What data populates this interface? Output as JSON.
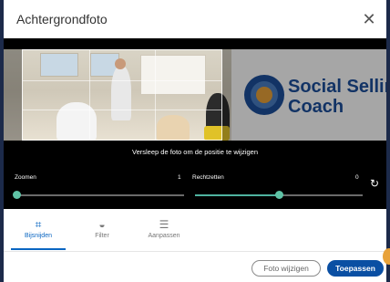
{
  "dialog": {
    "title": "Achtergrondfoto",
    "close_icon": "close-icon",
    "close_symbol": "✕"
  },
  "editor": {
    "hint": "Versleep de foto om de positie te wijzigen",
    "logo_text_line1": "Social Sellin",
    "logo_text_line2": "Coach",
    "zoom": {
      "label": "Zoomen",
      "value": "1",
      "level": 0
    },
    "straighten": {
      "label": "Rechtzetten",
      "value": "0",
      "level": 0.5
    },
    "rotate_icon": "rotate-icon",
    "rotate_symbol": "↻"
  },
  "tabs": [
    {
      "label": "Bijsnijden",
      "icon": "crop-icon",
      "symbol": "⌗",
      "active": true
    },
    {
      "label": "Filter",
      "icon": "filter-icon",
      "symbol": "◒",
      "active": false
    },
    {
      "label": "Aanpassen",
      "icon": "adjust-icon",
      "symbol": "☰",
      "active": false
    }
  ],
  "footer": {
    "secondary_label": "Foto wijzigen",
    "primary_label": "Toepassen"
  },
  "colors": {
    "accent": "#0a66c2",
    "primary_button": "#0a4fa3",
    "slider": "#5fc3a6",
    "logo_text": "#1c4f9c"
  }
}
